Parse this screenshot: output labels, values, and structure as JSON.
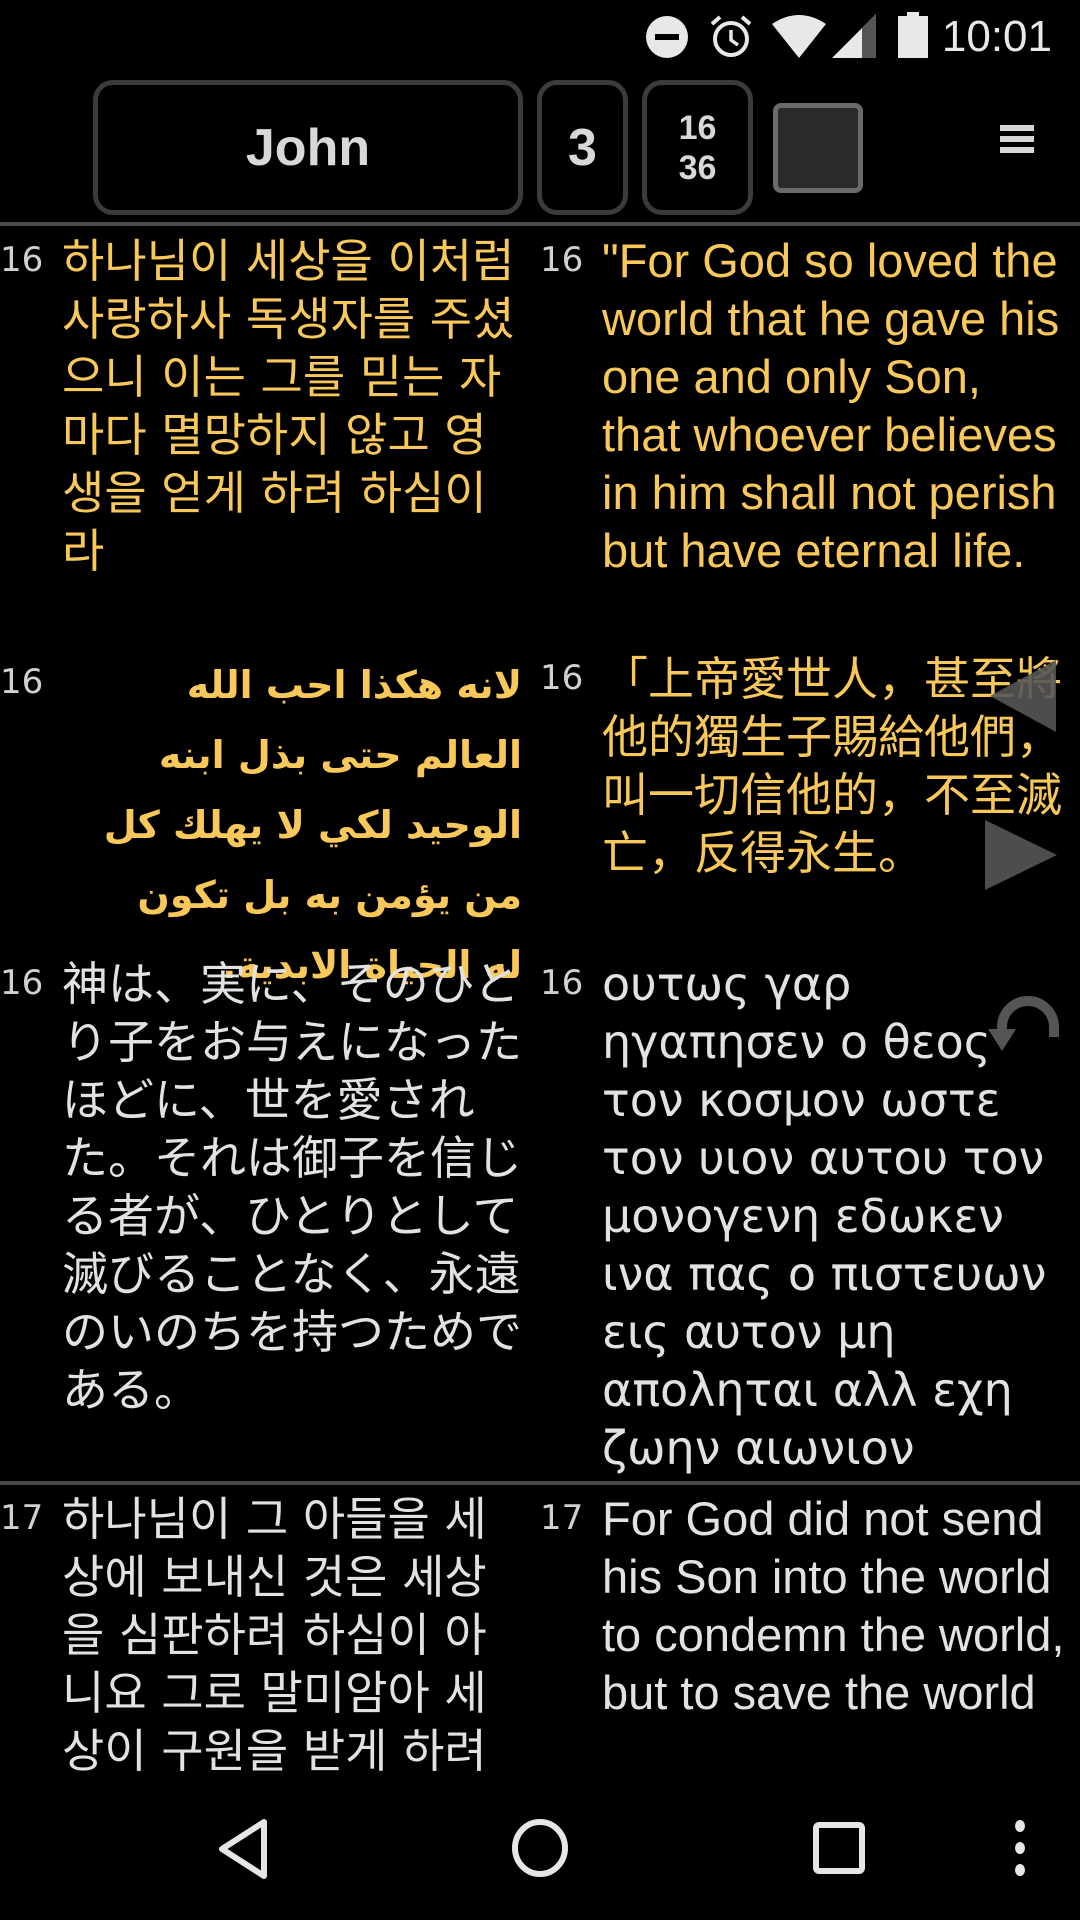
{
  "status_bar": {
    "time": "10:01",
    "icons": [
      "do-not-disturb-icon",
      "alarm-icon",
      "wifi-icon",
      "cell-signal-icon",
      "battery-icon"
    ]
  },
  "toolbar": {
    "book": "John",
    "chapter": "3",
    "verse_current": "16",
    "verse_total": "36",
    "color_swatch": "#2a2a2a",
    "menu_icon": "hamburger-menu-icon"
  },
  "colors": {
    "highlight": "#f9c85a",
    "normal_text": "#e2e2e2",
    "divider": "#4a4a4a",
    "background": "#000000"
  },
  "verses": [
    {
      "number": "16",
      "translations": [
        {
          "lang": "ko",
          "num": "16",
          "text": "하나님이 세상을 이처럼 사랑하사 독생자를 주셨으니 이는 그를 믿는 자마다 멸망하지 않고 영생을 얻게 하려 하심이라",
          "highlighted": true
        },
        {
          "lang": "en",
          "num": "16",
          "text": "\"For God so loved the world that he gave his one and only Son, that whoever believes in him shall not perish but have eternal life.",
          "highlighted": true
        },
        {
          "lang": "ar",
          "num": "16",
          "text": "لانه هكذا احب الله العالم حتى بذل ابنه الوحيد لكي لا يهلك كل من يؤمن به بل تكون له الحياة الابدية.",
          "highlighted": true
        },
        {
          "lang": "zh",
          "num": "16",
          "text": "「上帝愛世人，甚至將他的獨生子賜給他們，叫一切信他的，不至滅亡，反得永生。",
          "highlighted": true
        },
        {
          "lang": "ja",
          "num": "16",
          "text": " 神は、実に、そのひとり子をお与えになったほどに、世を愛された。それは御子を信じる者が、ひとりとして滅びることなく、永遠のいのちを持つためである。",
          "highlighted": false
        },
        {
          "lang": "el",
          "num": "16",
          "text": "ουτως γαρ ηγαπησεν ο θεος τον κοσμον ωστε τον υιον αυτου τον μονογενη εδωκεν ινα πας ο πιστευων εις αυτον μη αποληται αλλ εχη ζωην αιωνιον",
          "highlighted": false
        }
      ]
    },
    {
      "number": "17",
      "translations": [
        {
          "lang": "ko",
          "num": "17",
          "text": "하나님이 그 아들을 세상에 보내신 것은 세상을 심판하려 하심이 아니요 그로 말미암아 세상이 구원을 받게 하려",
          "highlighted": false
        },
        {
          "lang": "en",
          "num": "17",
          "text": "For God did not send his Son into the world to condemn the world, but to save the world",
          "highlighted": false
        }
      ]
    }
  ],
  "overlay": {
    "prev_icon": "previous-arrow-icon",
    "next_icon": "next-arrow-icon",
    "undo_icon": "undo-icon"
  },
  "nav_bar": {
    "back": "back-icon",
    "home": "home-icon",
    "recents": "recents-icon",
    "more": "more-vert-icon"
  }
}
